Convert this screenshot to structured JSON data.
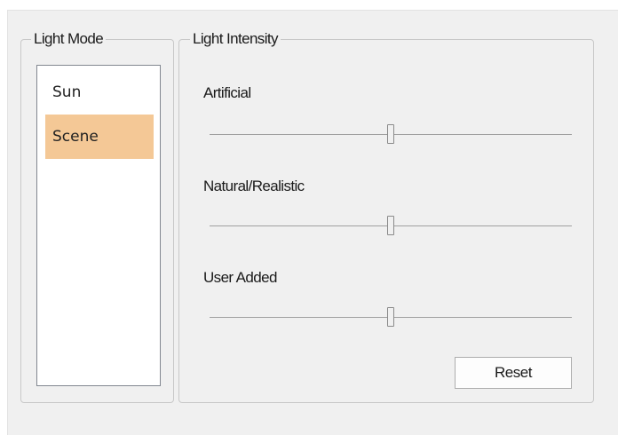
{
  "light_mode": {
    "title": "Light Mode",
    "items": [
      {
        "label": "Sun",
        "selected": false
      },
      {
        "label": "Scene",
        "selected": true
      }
    ]
  },
  "light_intensity": {
    "title": "Light Intensity",
    "sliders": [
      {
        "label": "Artificial",
        "value_fraction": 0.5
      },
      {
        "label": "Natural/Realistic",
        "value_fraction": 0.5
      },
      {
        "label": "User Added",
        "value_fraction": 0.5
      }
    ],
    "reset_label": "Reset"
  },
  "colors": {
    "selection": "#f4c896",
    "window_bg": "#f0f0f0"
  }
}
